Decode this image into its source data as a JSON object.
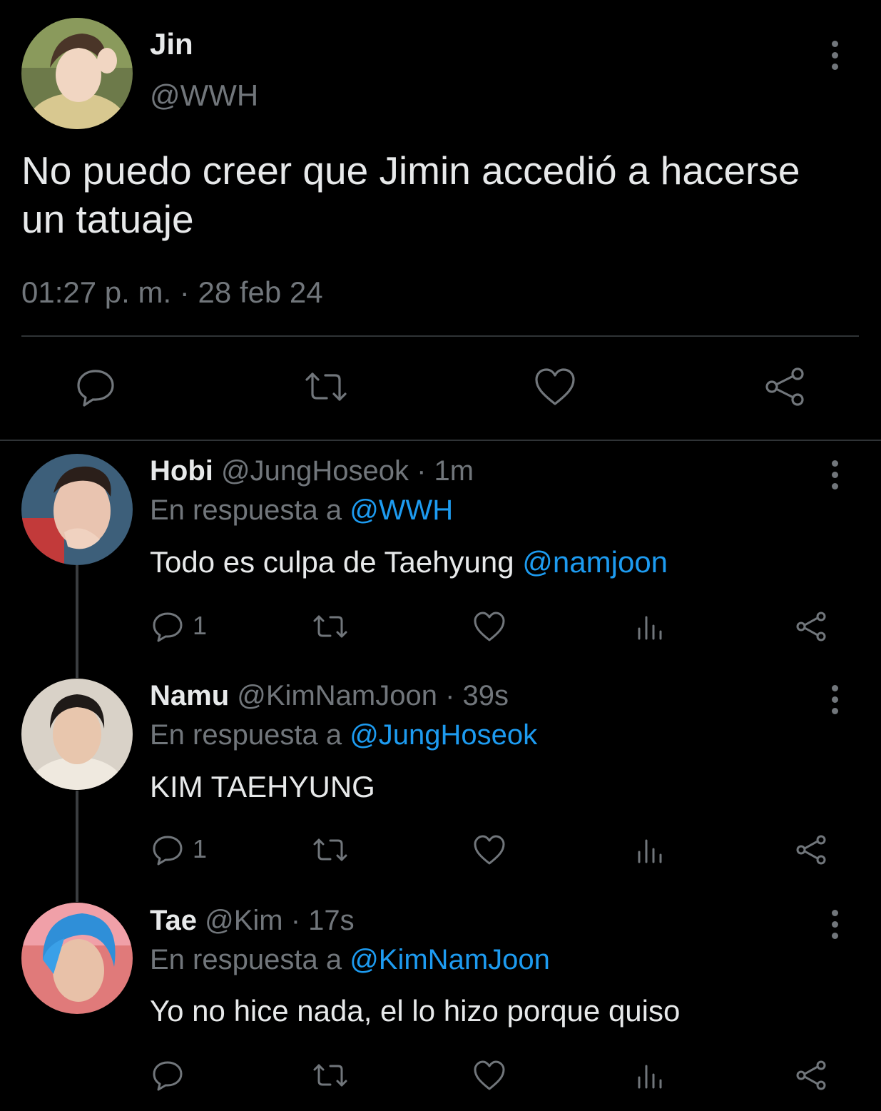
{
  "main_tweet": {
    "name": "Jin",
    "handle": "@WWH",
    "text_line1": "No puedo creer que Jimin accedió a hacerse",
    "text_line2": "un tatuaje",
    "time": "01:27 p. m.",
    "separator": "·",
    "date": "28 feb 24"
  },
  "replies": [
    {
      "name": "Hobi",
      "handle": "@JungHoseok",
      "time": "· 1m",
      "reply_prefix": "En respuesta a",
      "reply_to": "@WWH",
      "text": "Todo es culpa de Taehyung ",
      "mention": "@namjoon",
      "reply_count": "1"
    },
    {
      "name": "Namu",
      "handle": "@KimNamJoon",
      "time": "· 39s",
      "reply_prefix": "En respuesta a",
      "reply_to": "@JungHoseok",
      "text": "KIM TAEHYUNG",
      "mention": "",
      "reply_count": "1"
    },
    {
      "name": "Tae",
      "handle": "@Kim",
      "time": "· 17s",
      "reply_prefix": "En respuesta a",
      "reply_to": "@KimNamJoon",
      "text": "Yo no hice nada, el lo hizo porque quiso",
      "mention": "",
      "reply_count": ""
    }
  ],
  "colors": {
    "background": "#000000",
    "text": "#e7e9ea",
    "muted": "#71767b",
    "link": "#1d9bf0"
  },
  "icons": [
    "more-icon",
    "reply-icon",
    "retweet-icon",
    "like-icon",
    "views-icon",
    "share-icon"
  ]
}
